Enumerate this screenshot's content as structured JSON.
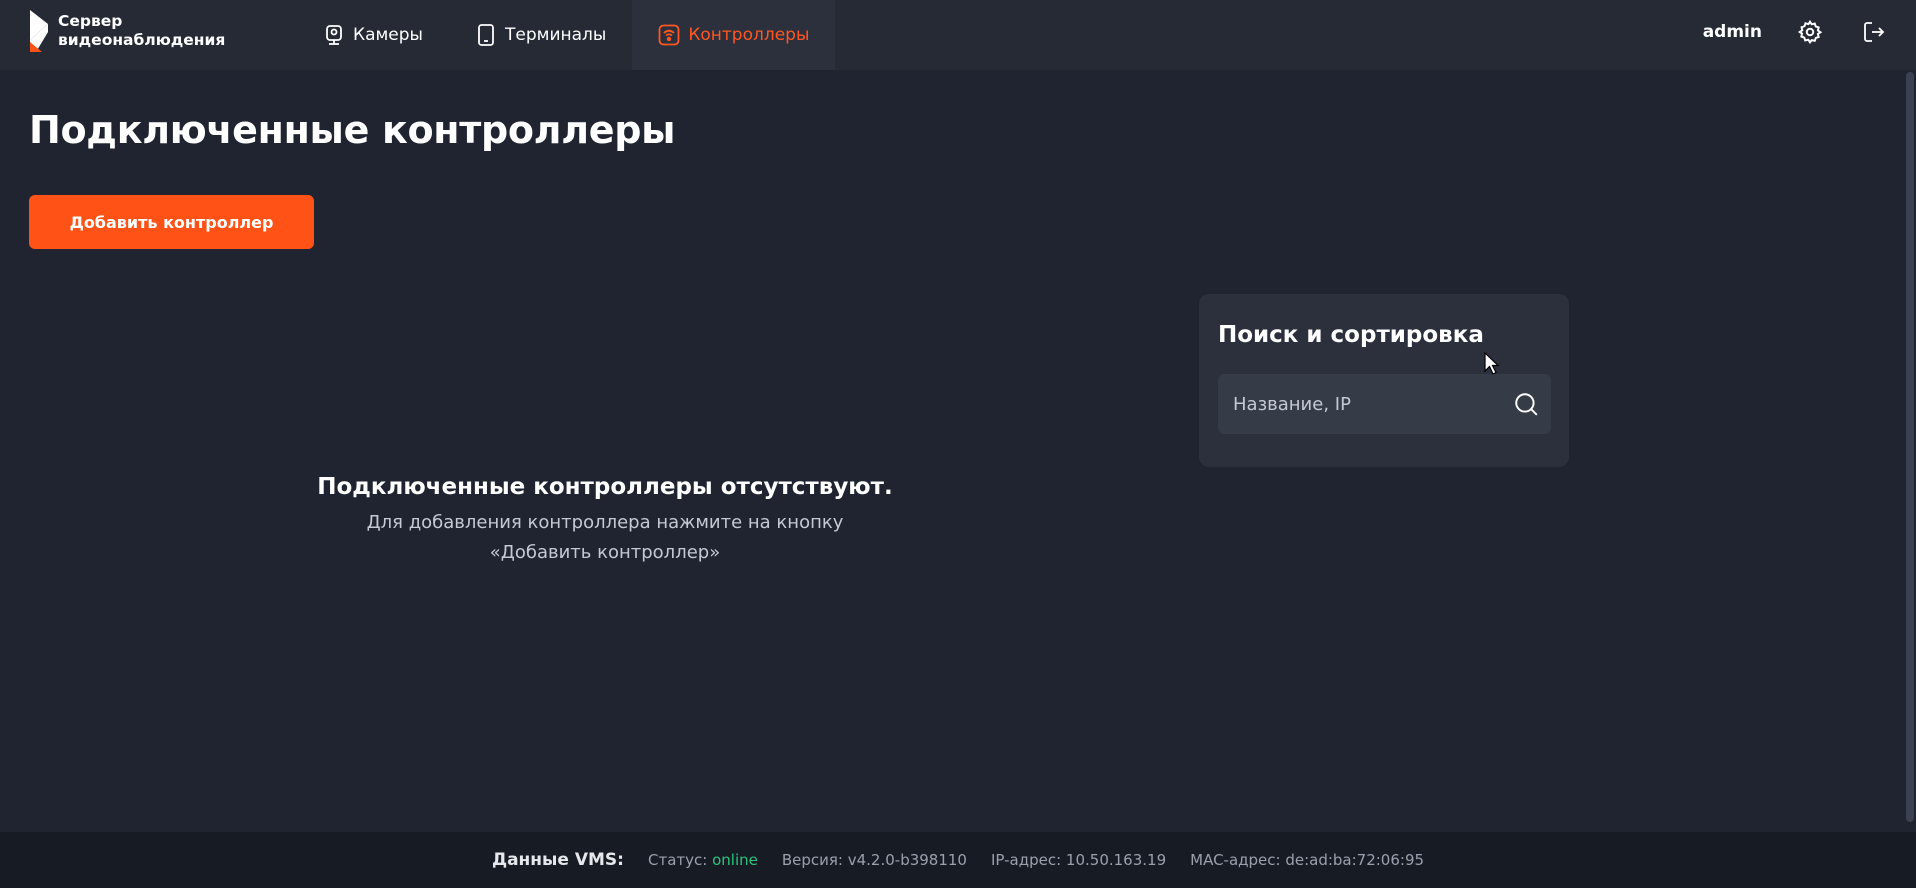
{
  "header": {
    "logo_text": "Сервер\nвидеонаблюдения",
    "nav": [
      {
        "label": "Камеры",
        "icon": "camera-icon"
      },
      {
        "label": "Терминалы",
        "icon": "tablet-icon"
      },
      {
        "label": "Контроллеры",
        "icon": "controller-icon",
        "active": true
      }
    ],
    "username": "admin",
    "settings_icon": "gear-icon",
    "logout_icon": "logout-icon"
  },
  "main": {
    "title": "Подключенные контроллеры",
    "add_button": "Добавить контроллер",
    "empty_title": "Подключенные контроллеры отсутствуют.",
    "empty_line1": "Для добавления контроллера нажмите на кнопку",
    "empty_line2": "«Добавить контроллер»"
  },
  "search_panel": {
    "title": "Поиск и сортировка",
    "placeholder": "Название, IP",
    "value": ""
  },
  "footer": {
    "label": "Данные VMS:",
    "status_label": "Статус:",
    "status_value": "online",
    "version": "Версия: v4.2.0-b398110",
    "ip": "IP-адрес: 10.50.163.19",
    "mac": "MAC-адрес: de:ad:ba:72:06:95"
  },
  "colors": {
    "accent": "#ff5216",
    "background": "#1f2430",
    "panel": "#2b303c",
    "online": "#2ec27e"
  }
}
